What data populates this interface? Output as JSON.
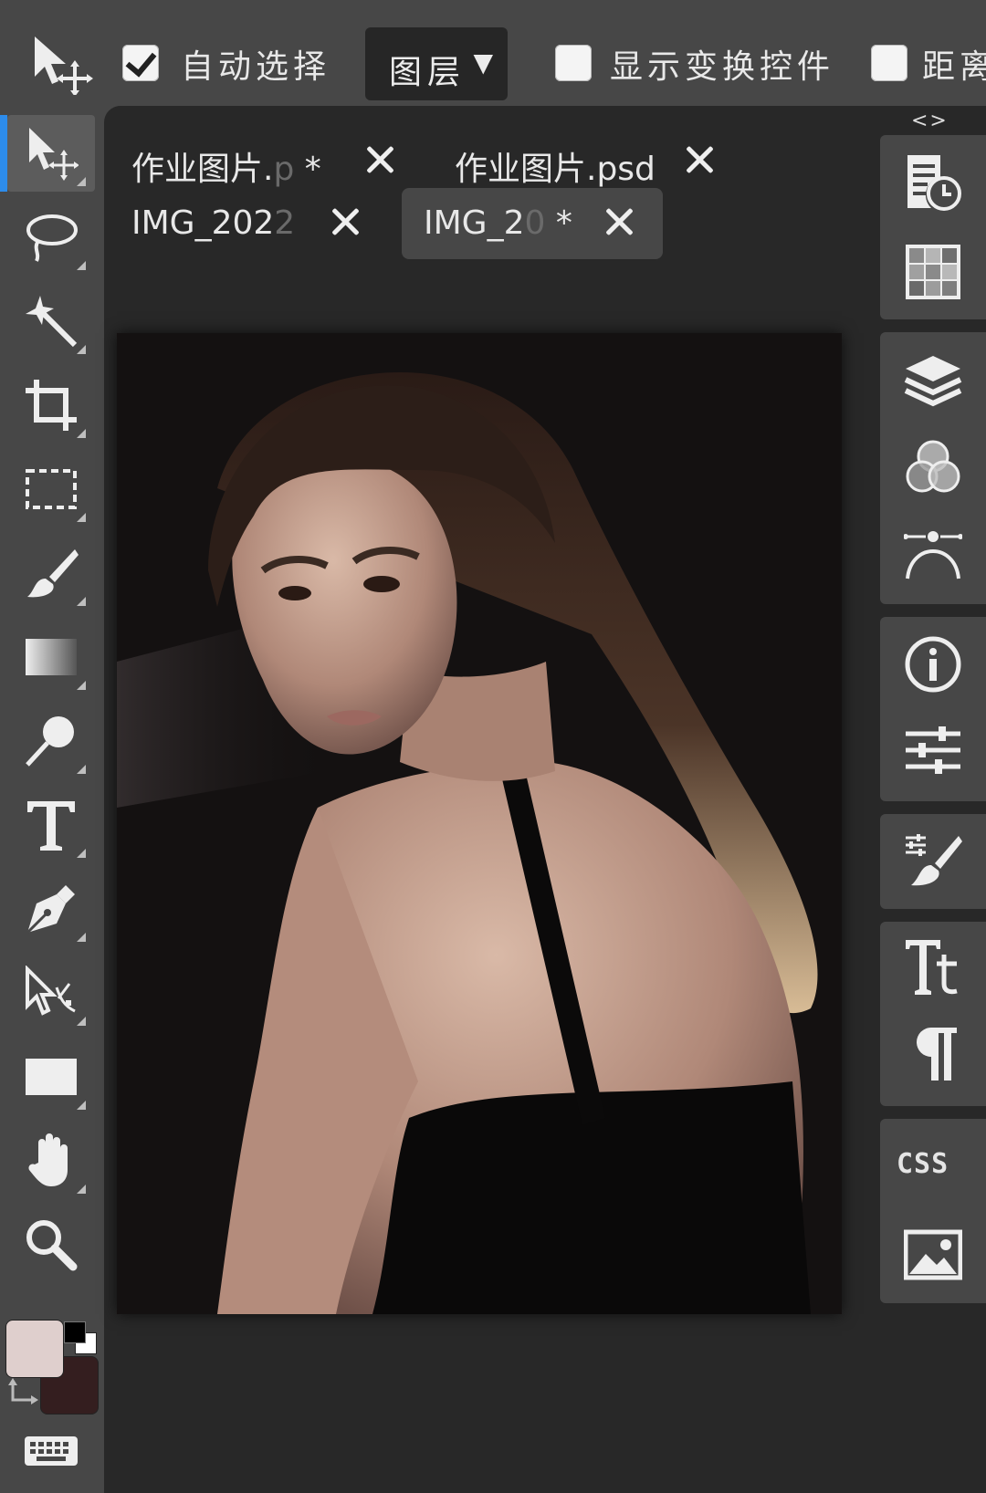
{
  "options_bar": {
    "auto_select": {
      "label": "自动选择",
      "checked": true
    },
    "layer_dropdown": {
      "value": "图层",
      "arrow": "▼"
    },
    "show_transform": {
      "label": "显示变换控件",
      "checked": false
    },
    "distance": {
      "label": "距离",
      "checked": false
    }
  },
  "tabs": [
    {
      "title": "作业图片.",
      "faded": "p",
      "suffix": " *",
      "active": false
    },
    {
      "title": "作业图片.psd",
      "faded": "",
      "suffix": "",
      "active": false
    },
    {
      "title": "IMG_202",
      "faded": "2",
      "suffix": "",
      "active": false
    },
    {
      "title": "IMG_2",
      "faded": "0",
      "suffix": " *",
      "active": true
    }
  ],
  "toolbar": {
    "tools": [
      "move-tool",
      "lasso-tool",
      "magic-wand-tool",
      "crop-tool",
      "marquee-tool",
      "brush-tool",
      "gradient-tool",
      "dodge-tool",
      "text-tool",
      "pen-tool",
      "path-select-tool",
      "rectangle-tool",
      "hand-tool",
      "zoom-tool"
    ],
    "active_tool": "move-tool",
    "foreground_color": "#dfcfcd",
    "background_color": "#341e1f"
  },
  "right_panel": {
    "collapse_label": "<>",
    "css_label": "CSS",
    "icons": [
      "history-icon",
      "swatches-icon",
      "layers-icon",
      "channels-icon",
      "paths-icon",
      "info-icon",
      "adjustments-icon",
      "brush-settings-icon",
      "character-icon",
      "paragraph-icon",
      "css-icon",
      "image-icon"
    ]
  },
  "canvas": {
    "subject": "portrait photo of a woman looking over her shoulder"
  },
  "colors": {
    "accent": "#2d8ceb",
    "panel": "#474747",
    "workspace": "#282828"
  }
}
